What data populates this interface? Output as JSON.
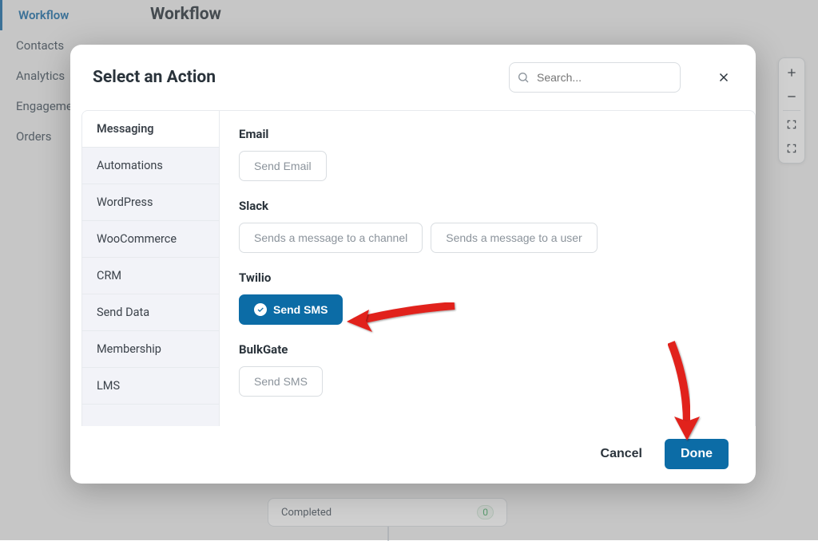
{
  "sidebar": {
    "items": [
      "Workflow",
      "Contacts",
      "Analytics",
      "Engagement",
      "Orders"
    ],
    "active_index": 0
  },
  "page_title": "Workflow",
  "tools": {
    "zoom_in": "+",
    "zoom_out": "−",
    "fit": "fit-icon",
    "fullscreen": "fullscreen-icon"
  },
  "background_node": {
    "label": "Completed",
    "count": "0"
  },
  "dialog": {
    "title": "Select an Action",
    "search_placeholder": "Search...",
    "categories": [
      "Messaging",
      "Automations",
      "WordPress",
      "WooCommerce",
      "CRM",
      "Send Data",
      "Membership",
      "LMS"
    ],
    "active_category_index": 0,
    "sections": {
      "email": {
        "label": "Email",
        "buttons": [
          "Send Email"
        ]
      },
      "slack": {
        "label": "Slack",
        "buttons": [
          "Sends a message to a channel",
          "Sends a message to a user"
        ]
      },
      "twilio": {
        "label": "Twilio",
        "buttons": [
          "Send SMS"
        ],
        "selected_index": 0
      },
      "bulkgate": {
        "label": "BulkGate",
        "buttons": [
          "Send SMS"
        ]
      }
    },
    "footer": {
      "cancel": "Cancel",
      "done": "Done"
    }
  },
  "accent_color": "#0c6ca6"
}
